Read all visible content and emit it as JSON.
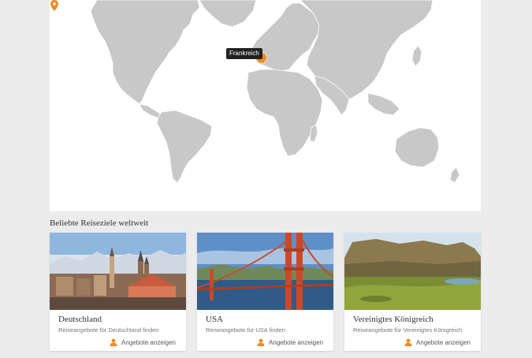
{
  "map": {
    "tooltip": "Frankreich",
    "pin_icon": "location-pin-icon",
    "land_color": "#c8c8c8",
    "highlight_color": "#f08a24"
  },
  "section": {
    "title": "Beliebte Reiseziele weltweit"
  },
  "cards": [
    {
      "title": "Deutschland",
      "subtitle": "Reiseangebote für Deutschland finden",
      "offer_label": "Angebote anzeigen",
      "offer_icon": "person-icon"
    },
    {
      "title": "USA",
      "subtitle": "Reiseangebote für USA finden",
      "offer_label": "Angebote anzeigen",
      "offer_icon": "person-icon"
    },
    {
      "title": "Vereinigtes Königreich",
      "subtitle": "Reiseangebote für Vereinigtes Königreich",
      "offer_label": "Angebote anzeigen",
      "offer_icon": "person-icon"
    }
  ],
  "colors": {
    "accent": "#f08a24",
    "background": "#ececec"
  }
}
